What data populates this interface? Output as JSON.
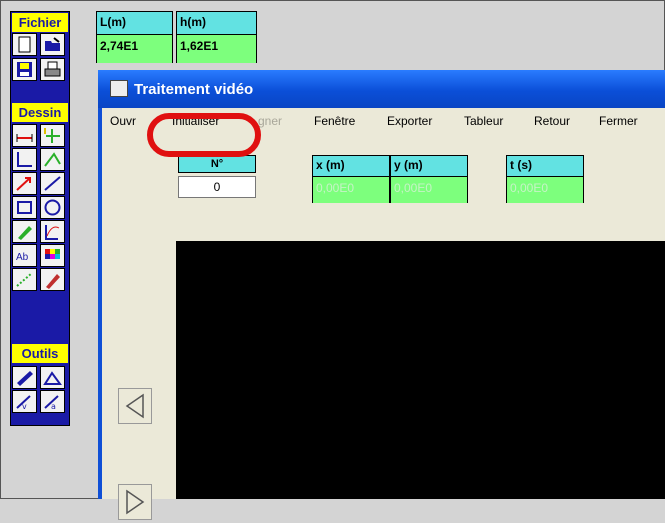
{
  "palette": {
    "headers": {
      "fichier": "Fichier",
      "dessin": "Dessin",
      "outils": "Outils"
    },
    "tools": {
      "fichier": [
        "new-file-icon",
        "open-folder-icon",
        "save-icon",
        "print-icon"
      ],
      "dessin": [
        "measure-length-icon",
        "add-point-icon",
        "axes-icon",
        "vector-sum-icon",
        "force-vector-icon",
        "line-icon",
        "rectangle-icon",
        "circle-icon",
        "pen-icon",
        "function-icon",
        "text-icon",
        "color-palette-icon",
        "dotted-line-icon",
        "eraser-icon"
      ],
      "outils": [
        "ruler-icon",
        "protractor-icon",
        "velocity-vector-icon",
        "acceleration-vector-icon"
      ]
    }
  },
  "values": {
    "length": {
      "label": "L(m)",
      "value": "2,74E1"
    },
    "height": {
      "label": "h(m)",
      "value": "1,62E1"
    }
  },
  "window": {
    "title": "Traitement vidéo",
    "menu": {
      "ouvrir": "Ouvr",
      "initialiser": "Initialiser",
      "etalonner": "gner",
      "fenetre": "Fenêtre",
      "exporter": "Exporter",
      "tableau": "Tableur",
      "retour": "Retour",
      "fermer": "Fermer"
    },
    "frame_counter": {
      "label": "N°",
      "value": "0"
    },
    "coords": {
      "x": {
        "label": "x (m)",
        "value": "0,00E0"
      },
      "y": {
        "label": "y (m)",
        "value": "0,00E0"
      },
      "t": {
        "label": "t (s)",
        "value": "0,00E0"
      }
    }
  },
  "colors": {
    "annotation": "#e01010",
    "palette_bg": "#1a1aa6",
    "header_yellow": "#ffff00",
    "value_green": "#7dff7d",
    "label_cyan": "#62e2e2"
  }
}
